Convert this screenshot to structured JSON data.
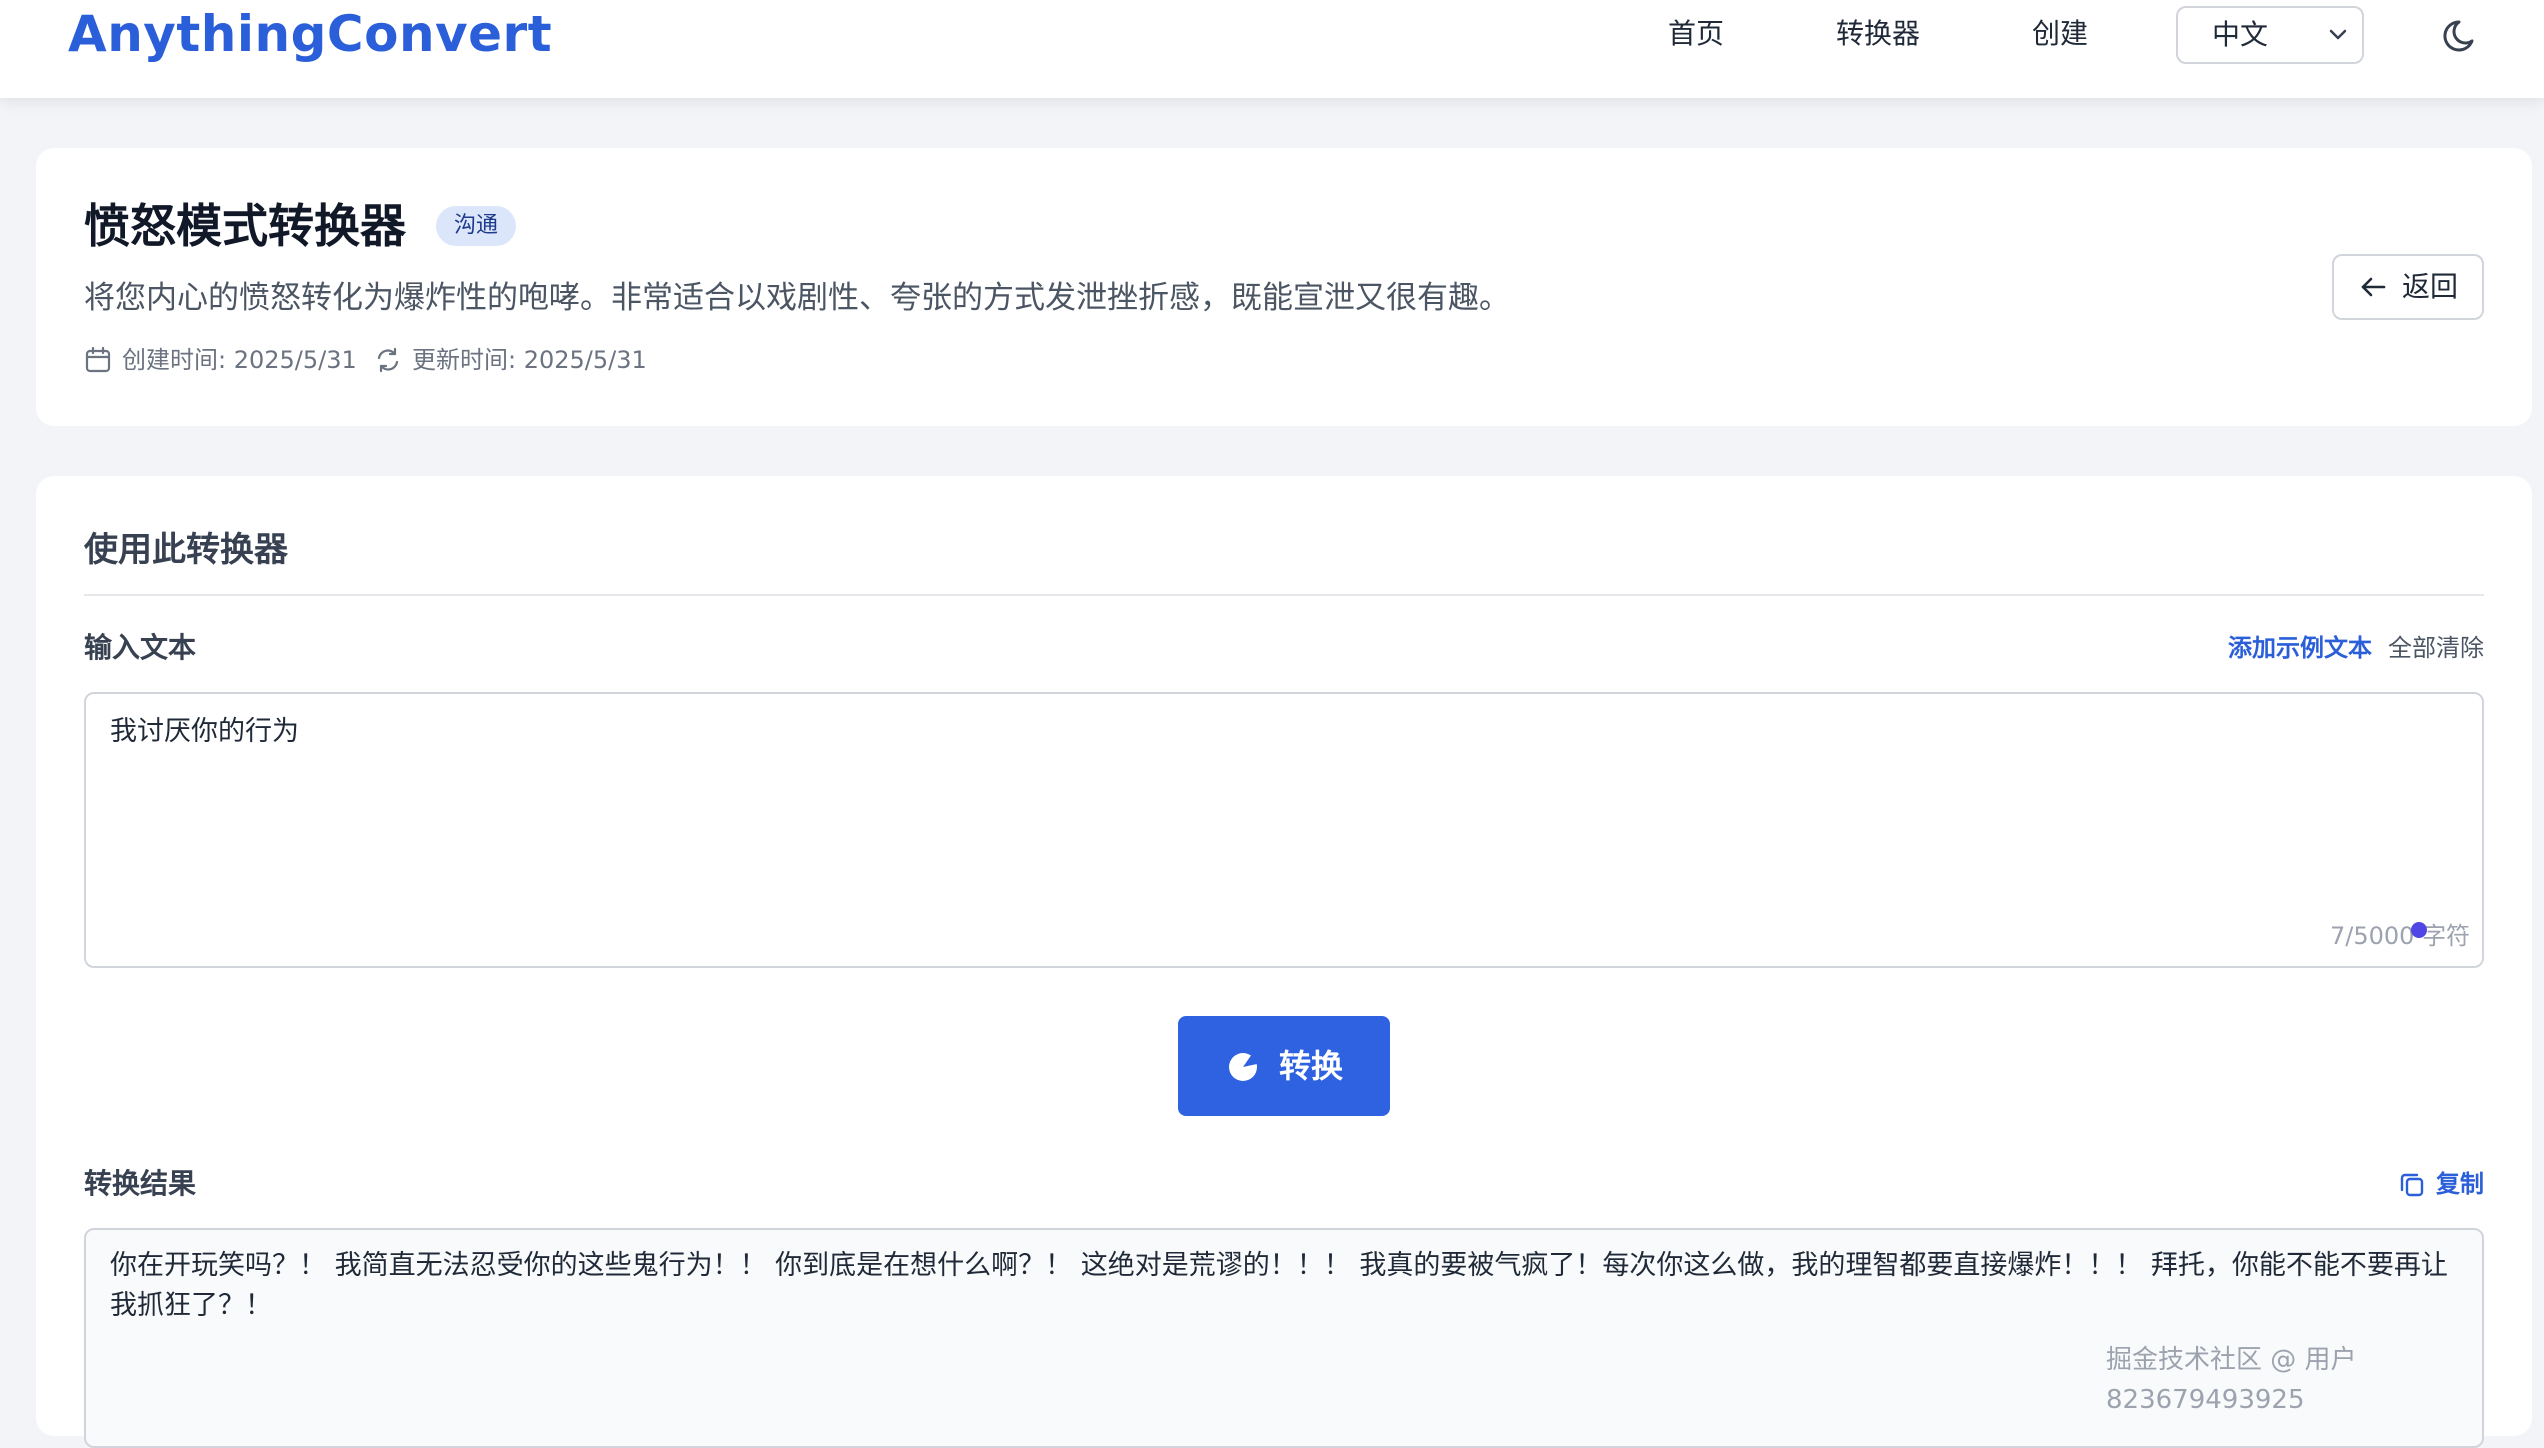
{
  "header": {
    "logo": "AnythingConvert",
    "nav": [
      "首页",
      "转换器",
      "创建"
    ],
    "language": "中文"
  },
  "converter": {
    "title": "愤怒模式转换器",
    "tag": "沟通",
    "description": "将您内心的愤怒转化为爆炸性的咆哮。非常适合以戏剧性、夸张的方式发泄挫折感，既能宣泄又很有趣。",
    "created": "创建时间: 2025/5/31",
    "updated": "更新时间: 2025/5/31",
    "back_label": "返回"
  },
  "use": {
    "section_title": "使用此转换器",
    "input_label": "输入文本",
    "add_example": "添加示例文本",
    "clear_all": "全部清除",
    "input_value": "我讨厌你的行为",
    "counter": "7/5000 字符",
    "convert_label": "转换",
    "result_label": "转换结果",
    "copy_label": "复制",
    "result_text": "你在开玩笑吗？！ 我简直无法忍受你的这些鬼行为！！ 你到底是在想什么啊？！ 这绝对是荒谬的！！！ 我真的要被气疯了！每次你这么做，我的理智都要直接爆炸！！！ 拜托，你能不能不要再让我抓狂了？！"
  },
  "watermark": "掘金技术社区 @ 用户823679493925",
  "colors": {
    "accent": "#2f62e0",
    "logo": "#2b5fd9",
    "tag_bg": "#dbe6fb",
    "page_bg": "#f3f4f7"
  }
}
